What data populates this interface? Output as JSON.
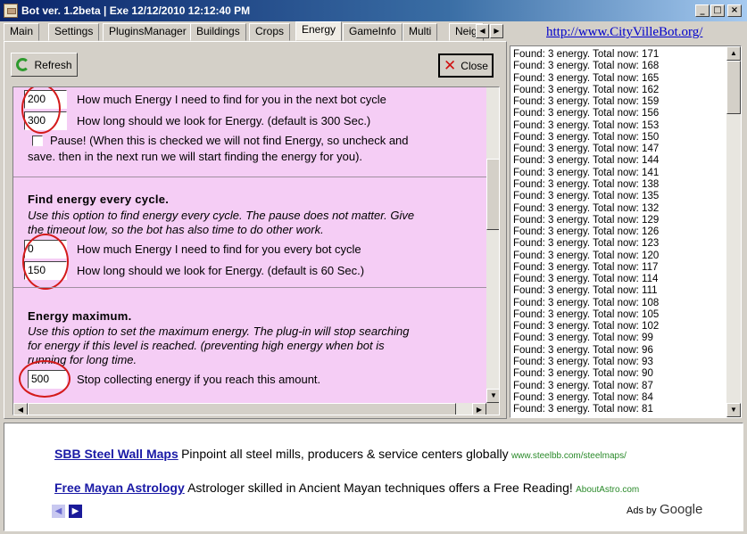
{
  "window": {
    "title": "Bot ver. 1.2beta | Exe 12/12/2010 12:12:40 PM",
    "controls": {
      "minimize": "_",
      "maximize": "□",
      "close": "×"
    }
  },
  "tabs": [
    {
      "label": "Main"
    },
    {
      "label": "Settings"
    },
    {
      "label": "PluginsManager"
    },
    {
      "label": "Buildings"
    },
    {
      "label": "Crops"
    },
    {
      "label": "Energy"
    },
    {
      "label": "GameInfo"
    },
    {
      "label": "Multi"
    },
    {
      "label": "Neig"
    }
  ],
  "active_tab": "Energy",
  "toolbar": {
    "refresh_label": "Refresh",
    "close_label": "Close"
  },
  "energy": {
    "next_cycle": {
      "amount_value": "200",
      "amount_label": "How much Energy I need to find for you in the next bot cycle",
      "time_value": "300",
      "time_label": "How long should we look for Energy. (default is 300 Sec.)",
      "pause_label_1": "Pause! (When this is checked we will not find Energy, so uncheck and",
      "pause_label_2": "save. then in the next run we will start finding the energy for you)."
    },
    "every_cycle": {
      "heading": "Find energy every cycle.",
      "desc_1": "Use this option to find energy every cycle. The pause does not matter. Give",
      "desc_2": "the timeout low, so the bot has also time to do other work.",
      "amount_value": "0",
      "amount_label": "How much Energy I need to find for you every bot cycle",
      "time_value": "150",
      "time_label": "How long should we look for Energy. (default is 60 Sec.)"
    },
    "maximum": {
      "heading": "Energy maximum.",
      "desc_1": "Use this option to set the maximum energy. The plug-in will stop searching",
      "desc_2": "for energy if this level is reached. (preventing high energy when bot is",
      "desc_3": "running for long time.",
      "value": "500",
      "label": "Stop collecting energy if you reach this amount."
    }
  },
  "site_link": "http://www.CityVilleBot.org/",
  "log": [
    "Found: 3 energy. Total now: 171",
    "Found: 3 energy. Total now: 168",
    "Found: 3 energy. Total now: 165",
    "Found: 3 energy. Total now: 162",
    "Found: 3 energy. Total now: 159",
    "Found: 3 energy. Total now: 156",
    "Found: 3 energy. Total now: 153",
    "Found: 3 energy. Total now: 150",
    "Found: 3 energy. Total now: 147",
    "Found: 3 energy. Total now: 144",
    "Found: 3 energy. Total now: 141",
    "Found: 3 energy. Total now: 138",
    "Found: 3 energy. Total now: 135",
    "Found: 3 energy. Total now: 132",
    "Found: 3 energy. Total now: 129",
    "Found: 3 energy. Total now: 126",
    "Found: 3 energy. Total now: 123",
    "Found: 3 energy. Total now: 120",
    "Found: 3 energy. Total now: 117",
    "Found: 3 energy. Total now: 114",
    "Found: 3 energy. Total now: 111",
    "Found: 3 energy. Total now: 108",
    "Found: 3 energy. Total now: 105",
    "Found: 3 energy. Total now: 102",
    "Found: 3 energy. Total now: 99",
    "Found: 3 energy. Total now: 96",
    "Found: 3 energy. Total now: 93",
    "Found: 3 energy. Total now: 90",
    "Found: 3 energy. Total now: 87",
    "Found: 3 energy. Total now: 84",
    "Found: 3 energy. Total now: 81"
  ],
  "ads": [
    {
      "title": "SBB Steel Wall Maps",
      "text": "Pinpoint all steel mills, producers & service centers globally",
      "url": "www.steelbb.com/steelmaps/"
    },
    {
      "title": "Free Mayan Astrology",
      "text": "Astrologer skilled in Ancient Mayan techniques offers a Free Reading!",
      "url": "AboutAstro.com"
    }
  ],
  "ads_by": {
    "prefix": "Ads by",
    "brand": "Google"
  },
  "icons": [
    "app-icon",
    "refresh-icon",
    "close-icon",
    "prev-arrow-icon",
    "next-arrow-icon"
  ]
}
